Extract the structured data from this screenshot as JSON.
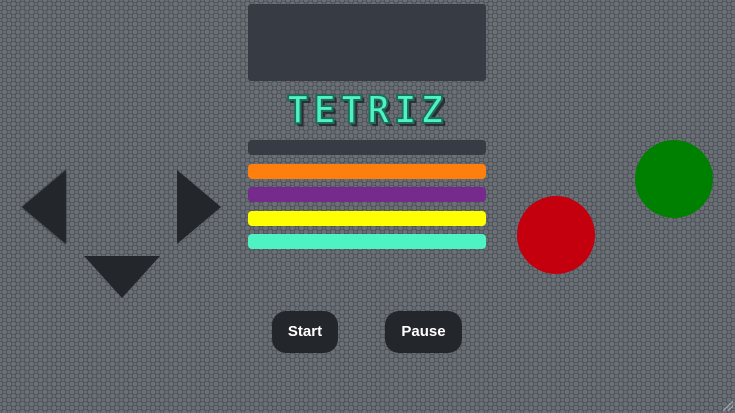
{
  "game": {
    "title": "TETRIZ"
  },
  "bars": [
    {
      "color": "#373b43"
    },
    {
      "color": "#ff7f0e"
    },
    {
      "color": "#762a8c"
    },
    {
      "color": "#ffff00"
    },
    {
      "color": "#4ef3c3"
    }
  ],
  "controls": {
    "start_label": "Start",
    "pause_label": "Pause",
    "icons": [
      "arrow-left-icon",
      "arrow-right-icon",
      "arrow-down-icon"
    ],
    "button_colors": {
      "red": "#c4000e",
      "green": "#008000"
    }
  }
}
